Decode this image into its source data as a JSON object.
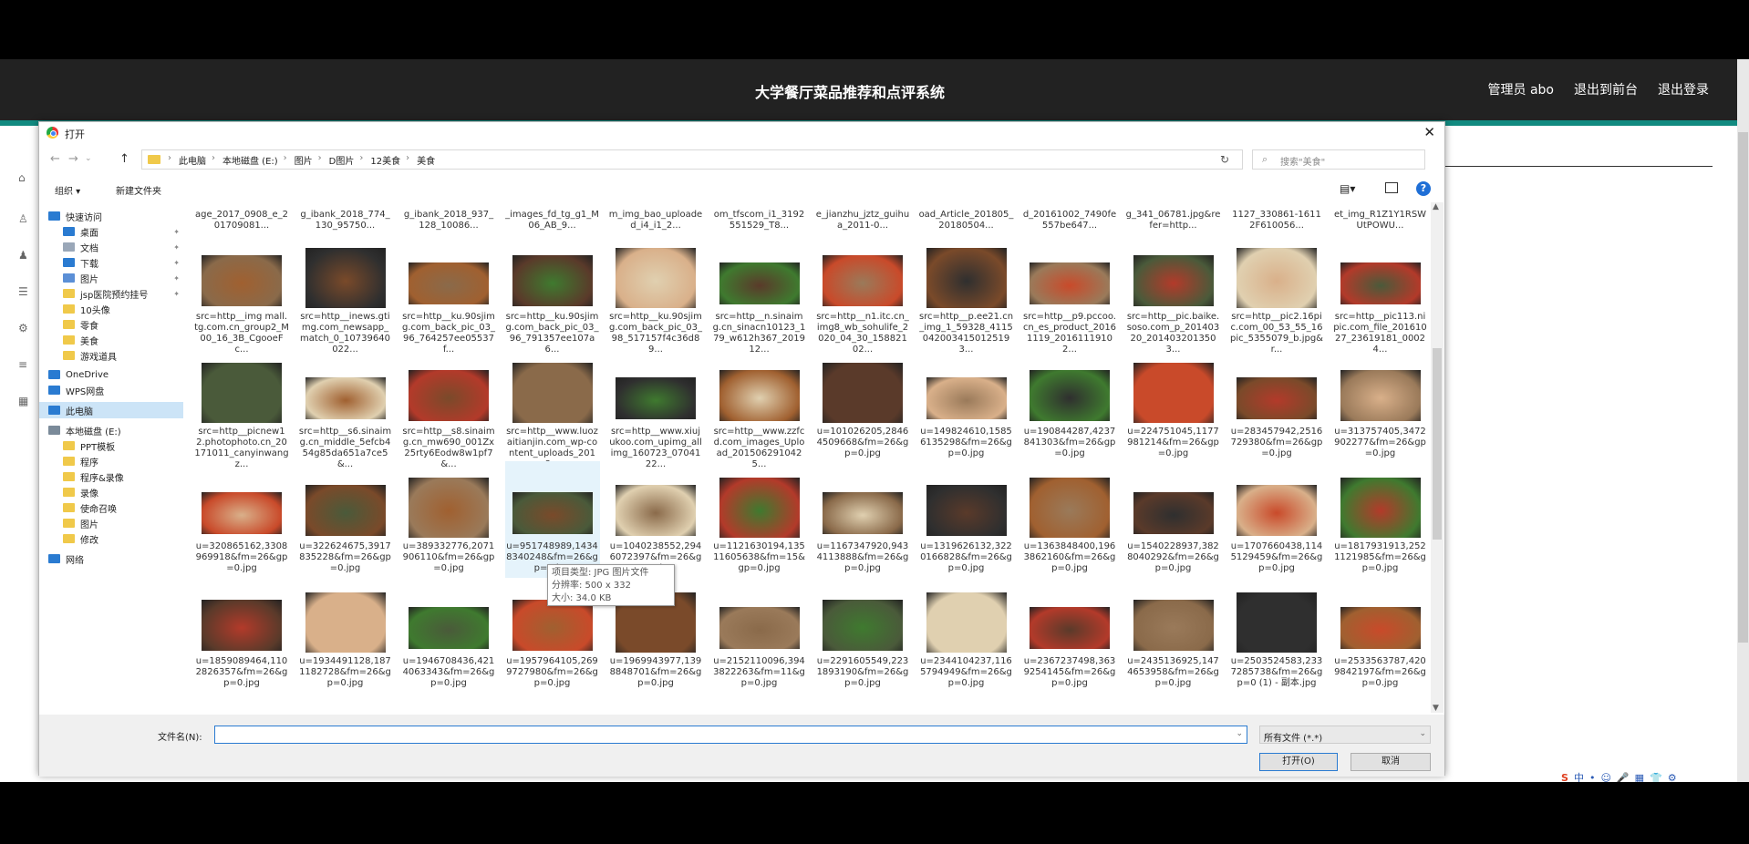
{
  "app": {
    "title": "大学餐厅菜品推荐和点评系统",
    "links": [
      "管理员 abo",
      "退出到前台",
      "退出登录"
    ]
  },
  "dialog": {
    "title": "打开",
    "breadcrumb": [
      "此电脑",
      "本地磁盘 (E:)",
      "图片",
      "D图片",
      "12美食",
      "美食"
    ],
    "search_placeholder": "搜索\"美食\"",
    "organize": "组织 ▾",
    "new_folder": "新建文件夹",
    "nav": [
      {
        "label": "快速访问",
        "type": "star"
      },
      {
        "label": "桌面",
        "type": "desk",
        "pin": true
      },
      {
        "label": "文档",
        "type": "doc",
        "pin": true
      },
      {
        "label": "下载",
        "type": "dl",
        "pin": true
      },
      {
        "label": "图片",
        "type": "pic",
        "pin": true
      },
      {
        "label": "jsp医院预约挂号",
        "type": "folder",
        "pin": true
      },
      {
        "label": "10头像",
        "type": "folder"
      },
      {
        "label": "零食",
        "type": "folder"
      },
      {
        "label": "美食",
        "type": "folder"
      },
      {
        "label": "游戏道具",
        "type": "folder"
      },
      {
        "label": "OneDrive",
        "type": "cloud"
      },
      {
        "label": "WPS网盘",
        "type": "cloud"
      },
      {
        "label": "此电脑",
        "type": "pc",
        "selected": true
      },
      {
        "label": "本地磁盘 (E:)",
        "type": "drive"
      },
      {
        "label": "PPT模板",
        "type": "folder"
      },
      {
        "label": "程序",
        "type": "folder"
      },
      {
        "label": "程序&录像",
        "type": "folder"
      },
      {
        "label": "录像",
        "type": "folder"
      },
      {
        "label": "使命召唤",
        "type": "folder"
      },
      {
        "label": "图片",
        "type": "folder"
      },
      {
        "label": "修改",
        "type": "folder"
      },
      {
        "label": "网络",
        "type": "net"
      }
    ],
    "files": [
      [
        "age_2017_0908_e_201709081...",
        "g_ibank_2018_774_130_95750...",
        "g_ibank_2018_937_128_10086...",
        "_images_fd_tg_g1_M06_AB_9...",
        "m_img_bao_uploaded_i4_i1_2...",
        "om_tfscom_i1_3192551529_T8...",
        "e_jianzhu_jztz_guihua_2011-0...",
        "oad_Article_201805_20180504...",
        "d_20161002_7490fe557be647...",
        "g_341_06781.jpg&refer=http...",
        "1127_330861-16112F610056...",
        "et_img_R1Z1Y1RSWUtPOWU..."
      ],
      [
        "src=http__img mall.tg.com.cn_group2_M00_16_3B_CgooeFc...",
        "src=http__inews.gtimg.com_newsapp_match_0_10739640022...",
        "src=http__ku.90sjimg.com_back_pic_03_96_764257ee05537f...",
        "src=http__ku.90sjimg.com_back_pic_03_96_791357ee107a6...",
        "src=http__ku.90sjimg.com_back_pic_03_98_517157f4c36d89...",
        "src=http__n.sinaimg.cn_sinacn10123_179_w612h367_201912...",
        "src=http__n1.itc.cn_img8_wb_sohulife_2020_04_30_15882102...",
        "src=http__p.ee21.cn_img_1_59328_41150420034150125193...",
        "src=http__p9.pccoo.cn_es_product_20161119_20161119102...",
        "src=http__pic.baike.soso.com_p_20140320_2014032013503...",
        "src=http__pic2.16pic.com_00_53_55_16pic_5355079_b.jpg&r...",
        "src=http__pic113.nipic.com_file_20161027_23619181_00024..."
      ],
      [
        "src=http__picnew12.photophoto.cn_20171011_canyinwangz...",
        "src=http__s6.sinaimg.cn_middle_5efcb454g85da651a7ce5&...",
        "src=http__s8.sinaimg.cn_mw690_001Zx25rty6Eodw8w1pf7&...",
        "src=http__www.luozaitianjin.com_wp-content_uploads_2018...",
        "src=http__www.xiujukoo.com_upimg_allimg_160723_0704122...",
        "src=http__www.zzfcd.com_images_Upload_2015062910425...",
        "u=101026205,28464509668&fm=26&gp=0.jpg",
        "u=149824610,15856135298&fm=26&gp=0.jpg",
        "u=190844287,4237841303&fm=26&gp=0.jpg",
        "u=224751045,1177981214&fm=26&gp=0.jpg",
        "u=283457942,2516729380&fm=26&gp=0.jpg",
        "u=313757405,3472902277&fm=26&gp=0.jpg"
      ],
      [
        "u=320865162,3308969918&fm=26&gp=0.jpg",
        "u=322624675,3917835228&fm=26&gp=0.jpg",
        "u=389332776,2071906110&fm=26&gp=0.jpg",
        "u=951748989,14348340248&fm=26&gp=0.jpg",
        "u=1040238552,2946072397&fm=26&gp=0.jpg",
        "u=1121630194,13511605638&fm=15&gp=0.jpg",
        "u=1167347920,9434113888&fm=26&gp=0.jpg",
        "u=1319626132,3220166828&fm=26&gp=0.jpg",
        "u=1363848400,1963862160&fm=26&gp=0.jpg",
        "u=1540228937,3828040292&fm=26&gp=0.jpg",
        "u=1707660438,1145129459&fm=26&gp=0.jpg",
        "u=1817931913,2521121985&fm=26&gp=0.jpg"
      ],
      [
        "u=1859089464,1102826357&fm=26&gp=0.jpg",
        "u=1934491128,1871182728&fm=26&gp=0.jpg",
        "u=1946708436,4214063343&fm=26&gp=0.jpg",
        "u=1957964105,2699727980&fm=26&gp=0.jpg",
        "u=1969943977,1398848701&fm=26&gp=0.jpg",
        "u=2152110096,3943822263&fm=11&gp=0.jpg",
        "u=2291605549,2231893190&fm=26&gp=0.jpg",
        "u=2344104237,1165794949&fm=26&gp=0.jpg",
        "u=2367237498,3639254145&fm=26&gp=0.jpg",
        "u=2435136925,1474653958&fm=26&gp=0.jpg",
        "u=2503524583,2337285738&fm=26&gp=0 (1) - 副本.jpg",
        "u=2533563787,4209842197&fm=26&gp=0.jpg"
      ]
    ],
    "tooltip": [
      "项目类型: JPG 图片文件",
      "分辨率: 500 x 332",
      "大小: 34.0 KB"
    ],
    "filename_label": "文件名(N):",
    "filename_value": "",
    "filetype": "所有文件 (*.*)",
    "open_label": "打开(O)",
    "cancel_label": "取消"
  },
  "tray": [
    "S",
    "中",
    "•",
    "☺",
    "🎤",
    "▦",
    "👕",
    "⚙"
  ]
}
